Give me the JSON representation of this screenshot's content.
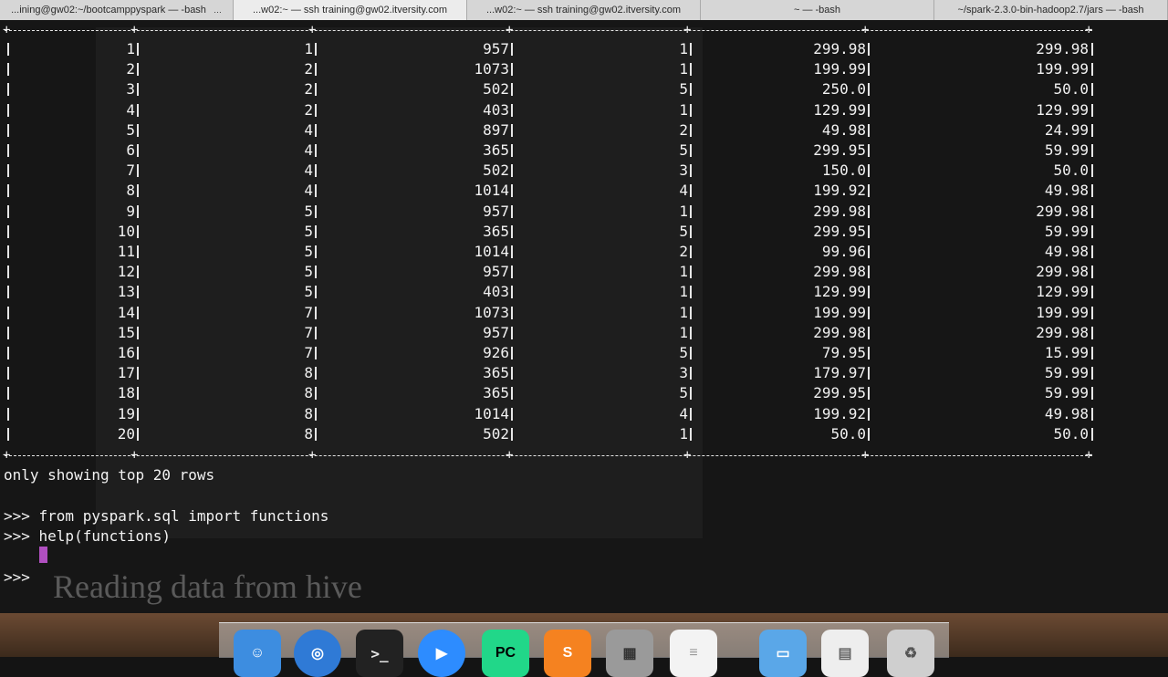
{
  "tabs": [
    {
      "label": "...ining@gw02:~/bootcamppyspark — -bash"
    },
    {
      "label": "...w02:~ — ssh training@gw02.itversity.com"
    },
    {
      "label": "...w02:~ — ssh training@gw02.itversity.com"
    },
    {
      "label": "~ — -bash"
    },
    {
      "label": "~/spark-2.3.0-bin-hadoop2.7/jars — -bash"
    }
  ],
  "table": {
    "rows": [
      [
        "1",
        "1",
        "957",
        "1",
        "299.98",
        "299.98"
      ],
      [
        "2",
        "2",
        "1073",
        "1",
        "199.99",
        "199.99"
      ],
      [
        "3",
        "2",
        "502",
        "5",
        "250.0",
        "50.0"
      ],
      [
        "4",
        "2",
        "403",
        "1",
        "129.99",
        "129.99"
      ],
      [
        "5",
        "4",
        "897",
        "2",
        "49.98",
        "24.99"
      ],
      [
        "6",
        "4",
        "365",
        "5",
        "299.95",
        "59.99"
      ],
      [
        "7",
        "4",
        "502",
        "3",
        "150.0",
        "50.0"
      ],
      [
        "8",
        "4",
        "1014",
        "4",
        "199.92",
        "49.98"
      ],
      [
        "9",
        "5",
        "957",
        "1",
        "299.98",
        "299.98"
      ],
      [
        "10",
        "5",
        "365",
        "5",
        "299.95",
        "59.99"
      ],
      [
        "11",
        "5",
        "1014",
        "2",
        "99.96",
        "49.98"
      ],
      [
        "12",
        "5",
        "957",
        "1",
        "299.98",
        "299.98"
      ],
      [
        "13",
        "5",
        "403",
        "1",
        "129.99",
        "129.99"
      ],
      [
        "14",
        "7",
        "1073",
        "1",
        "199.99",
        "199.99"
      ],
      [
        "15",
        "7",
        "957",
        "1",
        "299.98",
        "299.98"
      ],
      [
        "16",
        "7",
        "926",
        "5",
        "79.95",
        "15.99"
      ],
      [
        "17",
        "8",
        "365",
        "3",
        "179.97",
        "59.99"
      ],
      [
        "18",
        "8",
        "365",
        "5",
        "299.95",
        "59.99"
      ],
      [
        "19",
        "8",
        "1014",
        "4",
        "199.92",
        "49.98"
      ],
      [
        "20",
        "8",
        "502",
        "1",
        "50.0",
        "50.0"
      ]
    ]
  },
  "terminal": {
    "footer": "only showing top 20 rows",
    "cmd1": ">>> from pyspark.sql import functions",
    "cmd2": ">>> help(functions)",
    "prompt": ">>> "
  },
  "overlay": {
    "title": "Reading data from hive"
  },
  "dock": {
    "pycharm_label": "PC",
    "terminal_label": ">_",
    "colors": {
      "finder": "#3d8de0",
      "safari": "#2f7ad6",
      "terminal": "#222222",
      "zoom": "#2d8cff",
      "pycharm": "#21d789",
      "sublime": "#f58220"
    }
  }
}
